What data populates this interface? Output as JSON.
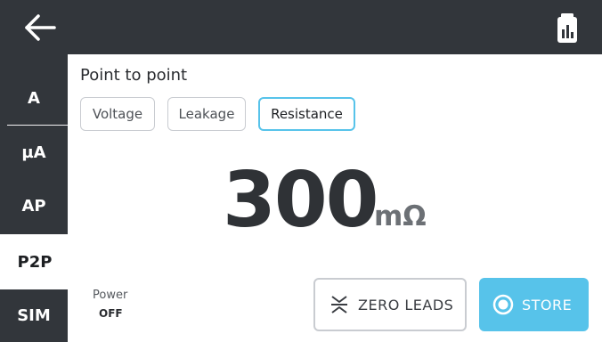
{
  "sidebar": {
    "items": [
      {
        "label": "A"
      },
      {
        "label": "µA"
      },
      {
        "label": "AP"
      },
      {
        "label": "P2P"
      },
      {
        "label": "SIM"
      }
    ],
    "active": "P2P"
  },
  "main": {
    "title": "Point to point",
    "tabs": [
      {
        "label": "Voltage"
      },
      {
        "label": "Leakage"
      },
      {
        "label": "Resistance"
      }
    ],
    "active_tab": "Resistance",
    "reading": {
      "value": "300",
      "unit": "mΩ"
    },
    "power": {
      "label": "Power",
      "value": "OFF"
    },
    "buttons": {
      "zero_leads": "ZERO LEADS",
      "store": "STORE"
    }
  },
  "icons": {
    "back": "arrow-left-icon",
    "report": "clipboard-chart-icon",
    "zero_leads": "zero-leads-icon",
    "store": "record-icon"
  },
  "colors": {
    "chrome": "#32363b",
    "accent": "#57c3ea",
    "background": "#ffffff"
  }
}
